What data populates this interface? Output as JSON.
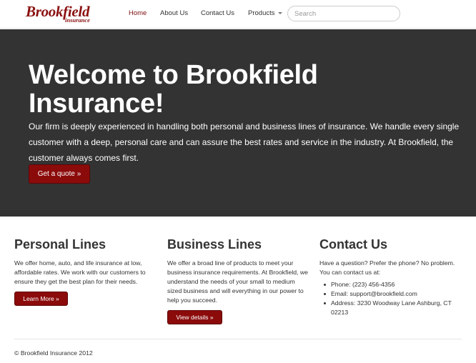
{
  "brand": {
    "name": "Brookfield",
    "tagline": "insurance"
  },
  "nav": {
    "items": [
      {
        "label": "Home",
        "active": true
      },
      {
        "label": "About Us"
      },
      {
        "label": "Contact Us"
      },
      {
        "label": "Products",
        "dropdown": true
      }
    ],
    "search_placeholder": "Search"
  },
  "hero": {
    "title": "Welcome to Brookfield Insurance!",
    "text": "Our firm is deeply experienced in handling both personal and business lines of insurance. We handle every single customer with a deep, personal care and can assure the best rates and service in the industry. At Brookfield, the customer always comes first.",
    "button": "Get a quote »"
  },
  "columns": {
    "personal": {
      "title": "Personal Lines",
      "text": "We offer home, auto, and life insurance at low, affordable rates. We work with our customers to ensure they get the best plan for their needs.",
      "button": "Learn More »"
    },
    "business": {
      "title": "Business Lines",
      "text": "We offer a broad line of products to meet your business insurance requirements. At Brookfield, we understand the needs of your small to medium sized business and will everything in our power to help you succeed.",
      "button": "View details »"
    },
    "contact": {
      "title": "Contact Us",
      "text": "Have a question? Prefer the phone? No problem. You can contact us at:",
      "items": [
        "Phone: (223) 456-4356",
        "Email: support@brookfield.com",
        "Address: 3230 Woodway Lane Ashburg, CT 02213"
      ]
    }
  },
  "footer": {
    "text": "© Brookfield Insurance 2012"
  },
  "colors": {
    "brand": "#8b1111",
    "button": "#8b0b0b",
    "hero_bg": "#333333"
  }
}
